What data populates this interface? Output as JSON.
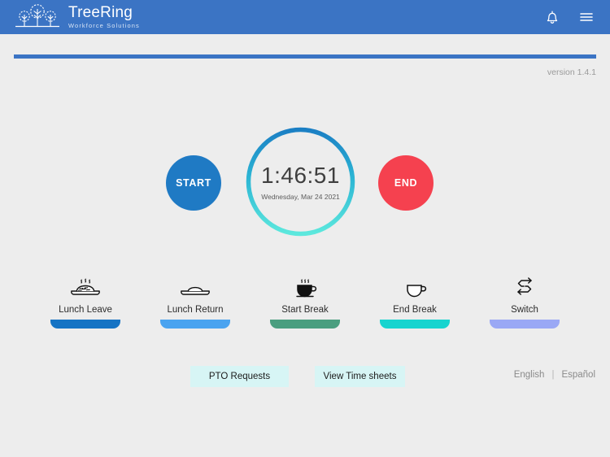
{
  "header": {
    "brand_name": "TreeRing",
    "brand_sub": "Workforce Solutions",
    "logo_icon": "tree-logo-icon",
    "notification_icon": "bell-icon",
    "menu_icon": "hamburger-menu-icon",
    "bg_color": "#3b74c4"
  },
  "divider": {
    "color": "#3b74c4"
  },
  "version": {
    "label": "version 1.4.1"
  },
  "clock": {
    "time": "1:46:51",
    "date": "Wednesday, Mar 24 2021",
    "ring_gradient_start": "#1b7fc4",
    "ring_gradient_end": "#5ce8dd"
  },
  "start_button": {
    "label": "START",
    "color": "#1f7ac4"
  },
  "end_button": {
    "label": "END",
    "color": "#f5414f"
  },
  "actions": [
    {
      "label": "Lunch Leave",
      "icon": "steaming-plate-icon",
      "bar_color": "#1573c4"
    },
    {
      "label": "Lunch Return",
      "icon": "empty-plate-icon",
      "bar_color": "#4aa3f0"
    },
    {
      "label": "Start Break",
      "icon": "steaming-cup-icon",
      "bar_color": "#4a9e7f"
    },
    {
      "label": "End Break",
      "icon": "empty-cup-icon",
      "bar_color": "#17d4cf"
    },
    {
      "label": "Switch",
      "icon": "switch-arrows-icon",
      "bar_color": "#9aa8f5"
    }
  ],
  "bottom": {
    "pto_label": "PTO Requests",
    "timesheets_label": "View Time sheets",
    "pill_color": "#d7f5f5"
  },
  "language": {
    "english": "English",
    "separator": "|",
    "spanish": "Español"
  }
}
